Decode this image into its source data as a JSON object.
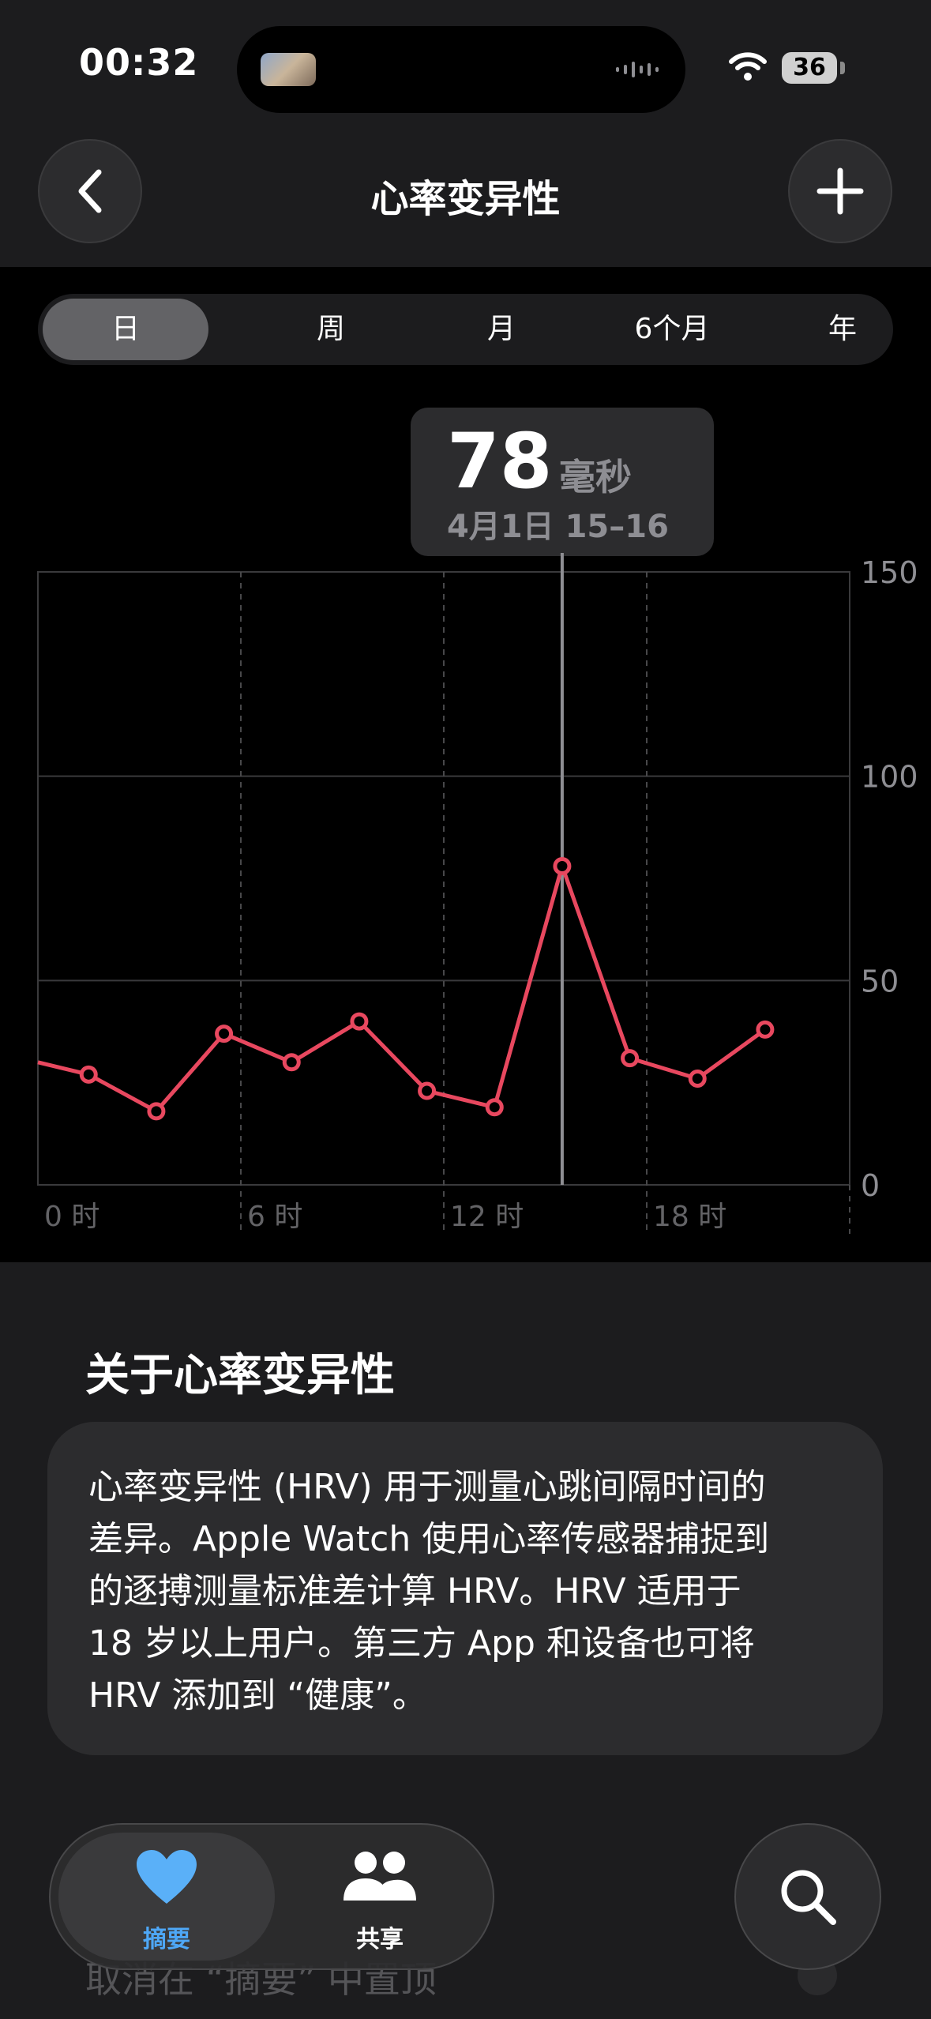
{
  "status": {
    "time": "00:32",
    "battery": "36"
  },
  "nav": {
    "title": "心率变异性"
  },
  "segments": [
    "日",
    "周",
    "月",
    "6个月",
    "年"
  ],
  "tooltip": {
    "value": "78",
    "unit": "毫秒",
    "date": "4月1日 15–16"
  },
  "about": {
    "title": "关于心率变异性",
    "lines": [
      "心率变异性 (HRV) 用于测量心跳间隔时间的",
      "差异。Apple Watch 使用心率传感器捕捉到",
      "的逐搏测量标准差计算 HRV。HRV 适用于",
      "18 岁以上用户。第三方 App 和设备也可将",
      "HRV 添加到 “健康”。"
    ]
  },
  "ghost": {
    "text": "取消在 “摘要” 中置顶"
  },
  "tabbar": {
    "summary": "摘要",
    "share": "共享"
  },
  "colors": {
    "line": "#e8485f",
    "accent": "#4ea7f6"
  },
  "chart_data": {
    "type": "line",
    "x_ticks": [
      "0 时",
      "6 时",
      "12 时",
      "18 时"
    ],
    "y_ticks": [
      "150",
      "100",
      "50",
      "0"
    ],
    "ylim": [
      0,
      150
    ],
    "xlim": [
      0,
      24
    ],
    "grid": true,
    "series": [
      {
        "x": [
          0.0,
          1.5,
          3.5,
          5.5,
          7.5,
          9.5,
          11.5,
          13.5,
          15.5,
          17.5,
          19.5,
          21.5
        ],
        "y": [
          30,
          27,
          18,
          37,
          30,
          40,
          23,
          19,
          78,
          31,
          26,
          38
        ]
      }
    ],
    "selected_x": 15.5
  }
}
